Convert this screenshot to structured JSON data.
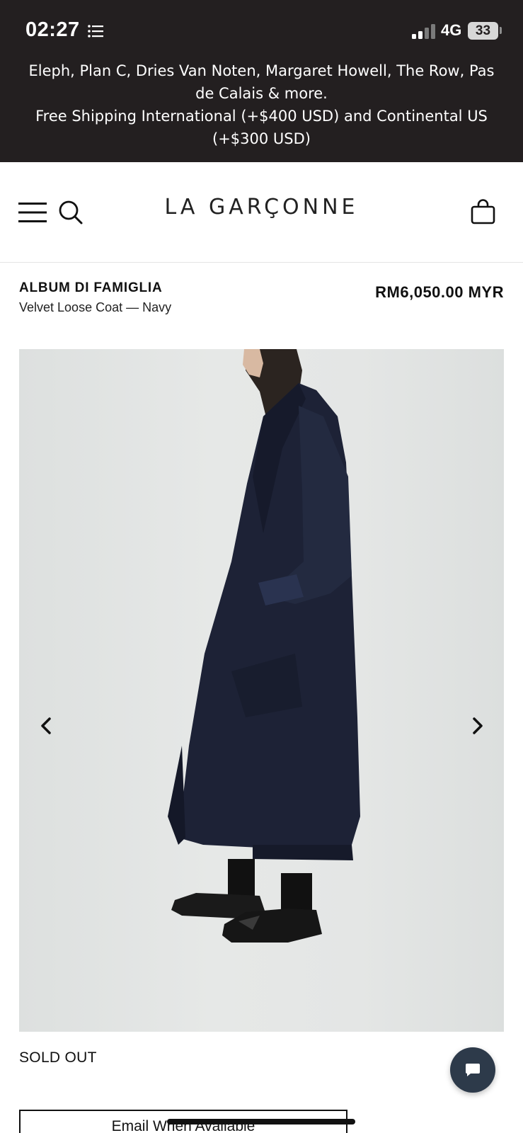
{
  "status_bar": {
    "time": "02:27",
    "network": "4G",
    "battery": "33"
  },
  "announcement": {
    "line1": "Eleph, Plan C, Dries Van Noten, Margaret Howell, The Row, Pas de Calais & more.",
    "line2": "Free Shipping International (+$400 USD) and Continental US (+$300 USD)"
  },
  "header": {
    "logo": "LA GARÇONNE"
  },
  "product": {
    "brand": "ALBUM DI FAMIGLIA",
    "name": "Velvet Loose Coat — Navy",
    "price": "RM6,050.00 MYR",
    "availability": "SOLD OUT",
    "notify_label": "Email When Available"
  },
  "colors": {
    "top_bar_bg": "#231f20",
    "coat_navy": "#1d2236",
    "chat_button": "#2d3a4a"
  },
  "icons": [
    "list-icon",
    "signal-icon",
    "menu-icon",
    "search-icon",
    "shopping-bag-icon",
    "chevron-left-icon",
    "chevron-right-icon",
    "chat-icon"
  ]
}
